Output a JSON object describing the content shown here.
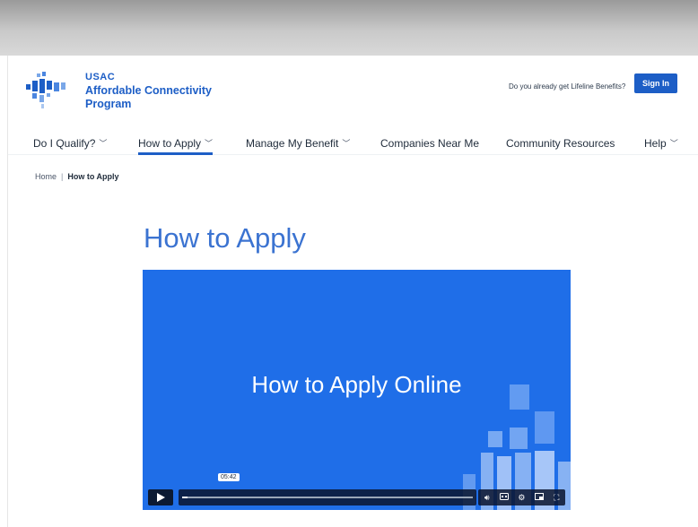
{
  "header": {
    "logo": {
      "org": "USAC",
      "program": "Affordable Connectivity Program"
    },
    "signin_question": "Do you already get Lifeline Benefits?",
    "signin_label": "Sign In"
  },
  "nav": {
    "items": [
      {
        "label": "Do I Qualify?",
        "has_dropdown": true,
        "active": false
      },
      {
        "label": "How to Apply",
        "has_dropdown": true,
        "active": true
      },
      {
        "label": "Manage My Benefit",
        "has_dropdown": true,
        "active": false
      },
      {
        "label": "Companies Near Me",
        "has_dropdown": false,
        "active": false
      },
      {
        "label": "Community Resources",
        "has_dropdown": false,
        "active": false
      },
      {
        "label": "Help",
        "has_dropdown": true,
        "active": false
      }
    ]
  },
  "breadcrumb": {
    "home": "Home",
    "current": "How to Apply"
  },
  "page_title": "How to Apply",
  "video": {
    "title": "How to Apply Online",
    "timestamp": "05:42",
    "progress": 0.02,
    "controls": [
      "volume-icon",
      "captions-icon",
      "settings-icon",
      "pip-icon",
      "fullscreen-icon"
    ]
  },
  "colors": {
    "brand_blue": "#1d5ec6",
    "title_blue": "#3b73d1",
    "video_bg": "#1f6ee8"
  }
}
